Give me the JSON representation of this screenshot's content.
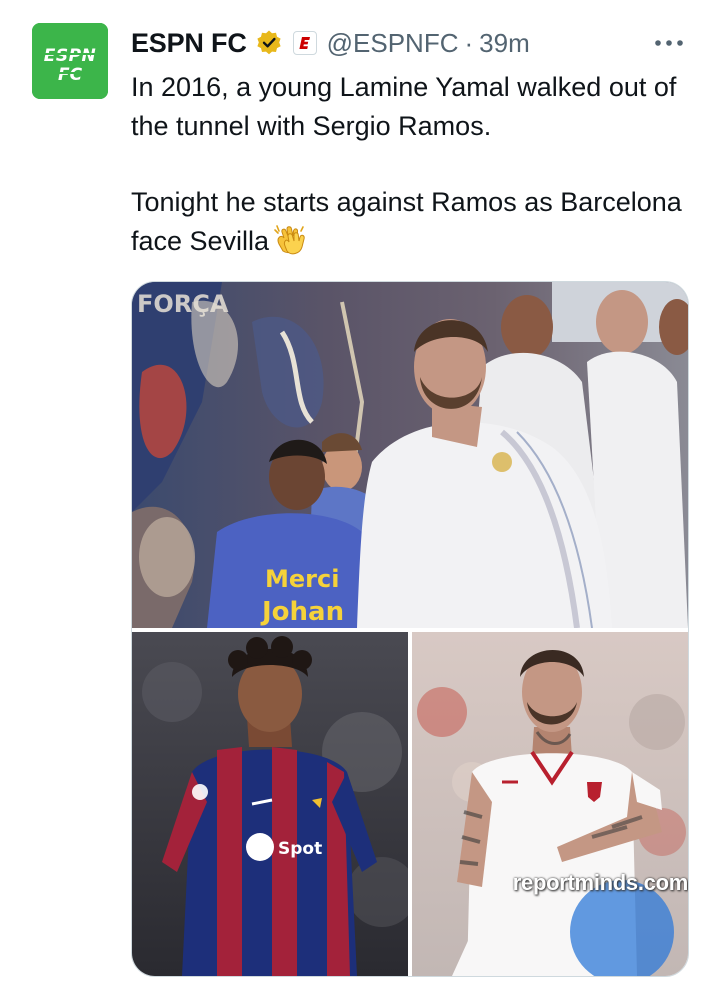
{
  "account": {
    "display_name": "ESPN FC",
    "handle": "@ESPNFC",
    "separator": "·",
    "time": "39m",
    "avatar_text": "ESPN FC"
  },
  "tweet": {
    "line1": "In 2016, a young Lamine Yamal walked out of the tunnel with Sergio Ramos.",
    "line2": "Tonight he starts against Ramos as Barcelona face Sevilla"
  },
  "media": {
    "photo1_shirt_text_1": "Merci",
    "photo1_shirt_text_2": "Johan",
    "photo2_sponsor": "Spot",
    "watermark": "reportminds.com"
  },
  "colors": {
    "espn_green": "#3cb54a",
    "verified_gold": "#e8b81a",
    "espn_red": "#cc0000",
    "secondary_text": "#536471"
  },
  "icons": {
    "verified": "verified-badge-icon",
    "affiliate": "espn-affiliate-icon",
    "more": "more-icon",
    "emoji": "clapping-hands-emoji"
  }
}
